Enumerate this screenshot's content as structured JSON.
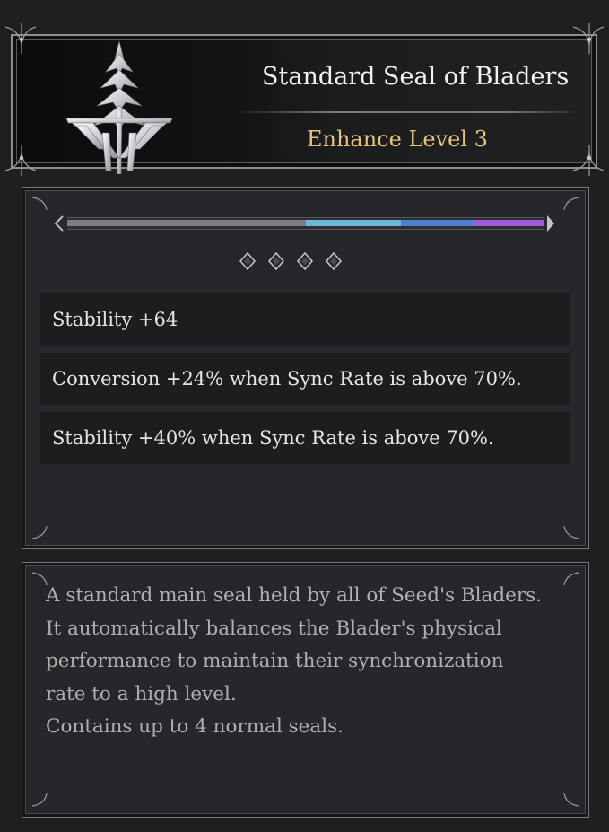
{
  "item": {
    "name": "Standard Seal of Bladers",
    "enhance_level": "Enhance Level 3"
  },
  "enhance_bar": {
    "segments": [
      {
        "color": "#7c7d82",
        "fraction": 0.5
      },
      {
        "color": "#6fb7d8",
        "fraction": 0.2
      },
      {
        "color": "#4f7fd0",
        "fraction": 0.15
      },
      {
        "color": "#a55be0",
        "fraction": 0.15
      }
    ]
  },
  "socket_slots": [
    "empty",
    "empty",
    "empty",
    "empty"
  ],
  "stats": [
    "Stability +64",
    "Conversion +24% when Sync Rate is above 70%.",
    "Stability +40% when Sync Rate is above 70%."
  ],
  "description": [
    "A standard main seal held by all of Seed's Bladers.",
    "It automatically balances the Blader's physical",
    "performance to maintain their synchronization",
    "rate to a high level.",
    "Contains up to 4 normal seals."
  ],
  "colors": {
    "title": "#f3f3f3",
    "enhance_level": "#e8c477",
    "stat_text": "#e6e6e6",
    "description_text": "#b0b0b3"
  }
}
